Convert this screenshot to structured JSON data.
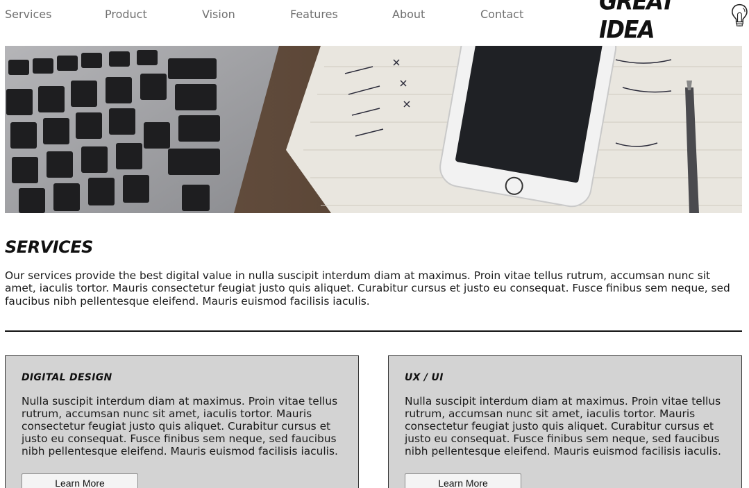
{
  "nav": {
    "items": [
      {
        "label": "Services"
      },
      {
        "label": "Product"
      },
      {
        "label": "Vision"
      },
      {
        "label": "Features"
      },
      {
        "label": "About"
      },
      {
        "label": "Contact"
      }
    ],
    "logo_text": "GREAT IDEA"
  },
  "hero": {
    "icon": "hero-photo-laptop-phone-notebook"
  },
  "services": {
    "title": "SERVICES",
    "intro": "Our services provide the best digital value in nulla suscipit interdum diam at maximus. Proin vitae tellus rutrum, accumsan nunc sit amet, iaculis tortor. Mauris consectetur feugiat justo quis aliquet. Curabitur cursus et justo eu consequat. Fusce finibus sem neque, sed faucibus nibh pellentesque eleifend. Mauris euismod facilisis iaculis."
  },
  "cards": [
    {
      "title": "DIGITAL DESIGN",
      "text": "Nulla suscipit interdum diam at maximus. Proin vitae tellus rutrum, accumsan nunc sit amet, iaculis tortor. Mauris consectetur feugiat justo quis aliquet. Curabitur cursus et justo eu consequat. Fusce finibus sem neque, sed faucibus nibh pellentesque eleifend. Mauris euismod facilisis iaculis.",
      "button": "Learn More"
    },
    {
      "title": "UX / UI",
      "text": "Nulla suscipit interdum diam at maximus. Proin vitae tellus rutrum, accumsan nunc sit amet, iaculis tortor. Mauris consectetur feugiat justo quis aliquet. Curabitur cursus et justo eu consequat. Fusce finibus sem neque, sed faucibus nibh pellentesque eleifend. Mauris euismod facilisis iaculis.",
      "button": "Learn More"
    }
  ]
}
